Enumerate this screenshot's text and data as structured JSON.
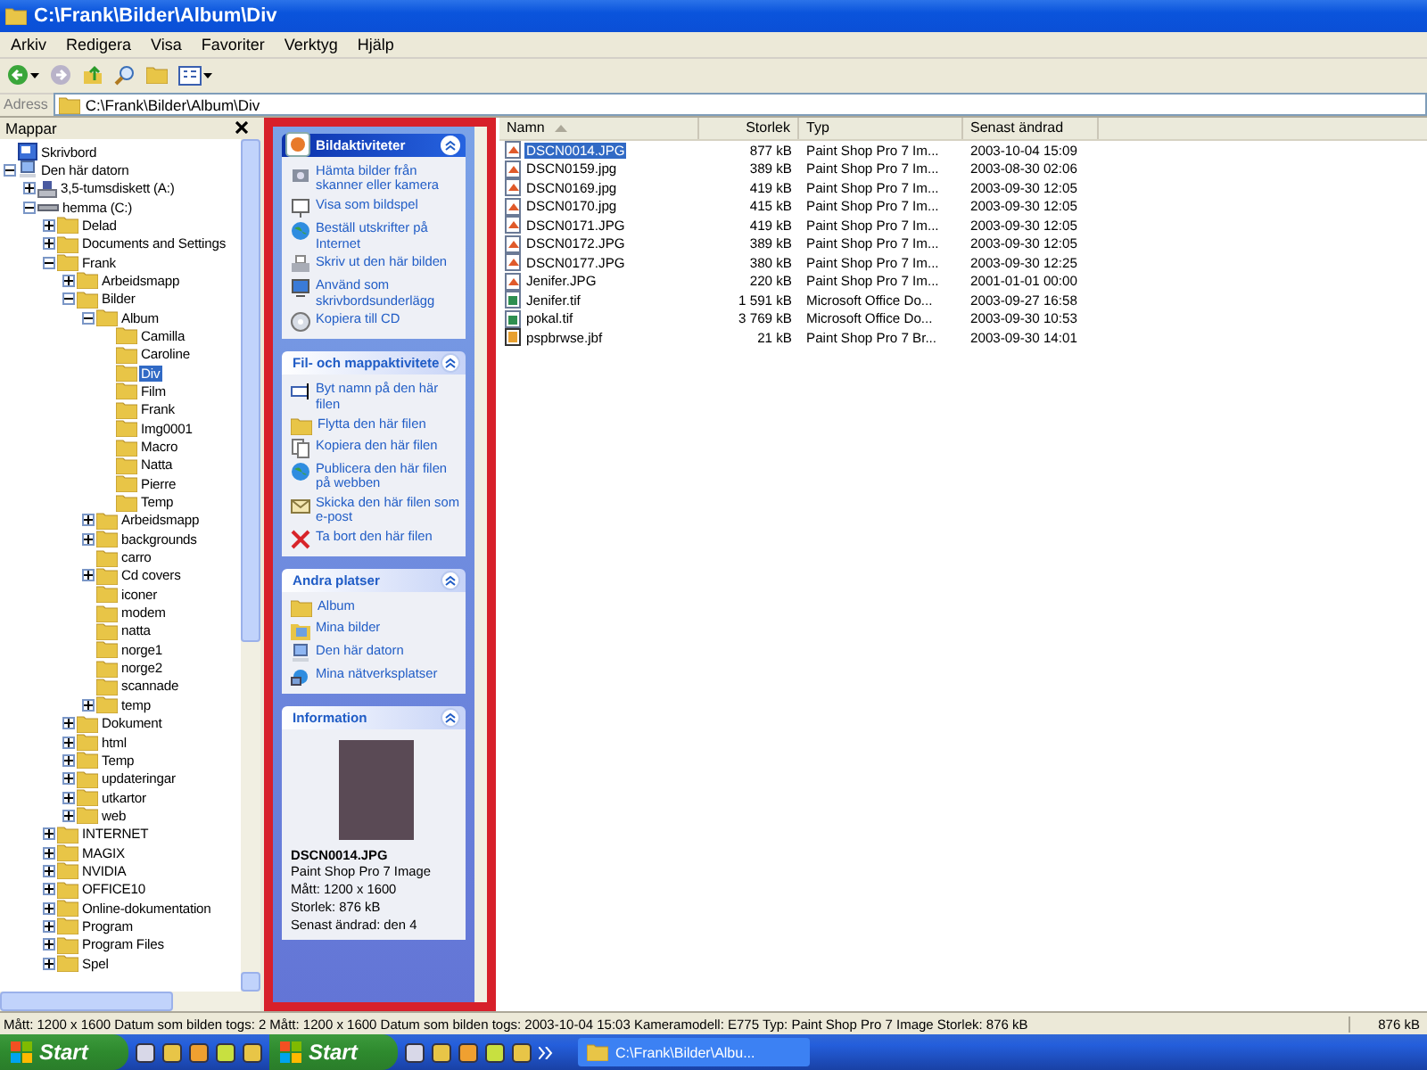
{
  "window": {
    "title": "C:\\Frank\\Bilder\\Album\\Div"
  },
  "menu": [
    "Arkiv",
    "Redigera",
    "Visa",
    "Favoriter",
    "Verktyg",
    "Hjälp"
  ],
  "address": {
    "label": "Adress",
    "value": "C:\\Frank\\Bilder\\Album\\Div"
  },
  "folders_pane": {
    "title": "Mappar",
    "tree": [
      {
        "label": "Skrivbord",
        "kind": "desktop",
        "selected": false
      },
      {
        "label": "Den här datorn",
        "kind": "computer",
        "expanded": true,
        "selected": false,
        "children": [
          {
            "label": "3,5-tumsdiskett (A:)",
            "kind": "floppy",
            "expanded": false,
            "selected": false
          },
          {
            "label": "hemma (C:)",
            "kind": "drive",
            "expanded": true,
            "selected": false,
            "children": [
              {
                "label": "Delad",
                "kind": "folder",
                "expanded": false,
                "selected": false
              },
              {
                "label": "Documents and Settings",
                "kind": "folder",
                "expanded": false,
                "selected": false
              },
              {
                "label": "Frank",
                "kind": "folder",
                "expanded": true,
                "selected": false,
                "children": [
                  {
                    "label": "Arbeidsmapp",
                    "kind": "folder",
                    "expanded": false,
                    "selected": false
                  },
                  {
                    "label": "Bilder",
                    "kind": "folder",
                    "expanded": true,
                    "selected": false,
                    "children": [
                      {
                        "label": "Album",
                        "kind": "folder",
                        "expanded": true,
                        "selected": false,
                        "children": [
                          {
                            "label": "Camilla",
                            "kind": "folder",
                            "selected": false
                          },
                          {
                            "label": "Caroline",
                            "kind": "folder",
                            "selected": false
                          },
                          {
                            "label": "Div",
                            "kind": "folder",
                            "selected": true
                          },
                          {
                            "label": "Film",
                            "kind": "folder",
                            "selected": false
                          },
                          {
                            "label": "Frank",
                            "kind": "folder",
                            "selected": false
                          },
                          {
                            "label": "Img0001",
                            "kind": "folder",
                            "selected": false
                          },
                          {
                            "label": "Macro",
                            "kind": "folder",
                            "selected": false
                          },
                          {
                            "label": "Natta",
                            "kind": "folder",
                            "selected": false
                          },
                          {
                            "label": "Pierre",
                            "kind": "folder",
                            "selected": false
                          },
                          {
                            "label": "Temp",
                            "kind": "folder",
                            "selected": false
                          }
                        ]
                      },
                      {
                        "label": "Arbeidsmapp",
                        "kind": "folder",
                        "expanded": false,
                        "selected": false
                      },
                      {
                        "label": "backgrounds",
                        "kind": "folder",
                        "expanded": false,
                        "selected": false
                      },
                      {
                        "label": "carro",
                        "kind": "folder",
                        "selected": false
                      },
                      {
                        "label": "Cd covers",
                        "kind": "folder",
                        "expanded": false,
                        "selected": false
                      },
                      {
                        "label": "iconer",
                        "kind": "folder",
                        "selected": false
                      },
                      {
                        "label": "modem",
                        "kind": "folder",
                        "selected": false
                      },
                      {
                        "label": "natta",
                        "kind": "folder",
                        "selected": false
                      },
                      {
                        "label": "norge1",
                        "kind": "folder",
                        "selected": false
                      },
                      {
                        "label": "norge2",
                        "kind": "folder",
                        "selected": false
                      },
                      {
                        "label": "scannade",
                        "kind": "folder",
                        "selected": false
                      },
                      {
                        "label": "temp",
                        "kind": "folder",
                        "expanded": false,
                        "selected": false
                      }
                    ]
                  },
                  {
                    "label": "Dokument",
                    "kind": "folder",
                    "expanded": false,
                    "selected": false
                  },
                  {
                    "label": "html",
                    "kind": "folder",
                    "expanded": false,
                    "selected": false
                  },
                  {
                    "label": "Temp",
                    "kind": "folder",
                    "expanded": false,
                    "selected": false
                  },
                  {
                    "label": "updateringar",
                    "kind": "folder",
                    "expanded": false,
                    "selected": false
                  },
                  {
                    "label": "utkartor",
                    "kind": "folder",
                    "expanded": false,
                    "selected": false
                  },
                  {
                    "label": "web",
                    "kind": "folder",
                    "expanded": false,
                    "selected": false
                  }
                ]
              },
              {
                "label": "INTERNET",
                "kind": "folder",
                "expanded": false,
                "selected": false
              },
              {
                "label": "MAGIX",
                "kind": "folder",
                "expanded": false,
                "selected": false
              },
              {
                "label": "NVIDIA",
                "kind": "folder",
                "expanded": false,
                "selected": false
              },
              {
                "label": "OFFICE10",
                "kind": "folder",
                "expanded": false,
                "selected": false
              },
              {
                "label": "Online-dokumentation",
                "kind": "folder",
                "expanded": false,
                "selected": false
              },
              {
                "label": "Program",
                "kind": "folder",
                "expanded": false,
                "selected": false
              },
              {
                "label": "Program Files",
                "kind": "folder",
                "expanded": false,
                "selected": false
              },
              {
                "label": "Spel",
                "kind": "folder",
                "expanded": false,
                "selected": false
              }
            ]
          }
        ]
      }
    ]
  },
  "task_pane": {
    "sections": [
      {
        "kind": "special",
        "title": "Bildaktiviteter",
        "items": [
          {
            "label": "Hämta bilder från skanner eller kamera",
            "kind": "camera"
          },
          {
            "label": "Visa som bildspel",
            "kind": "slideshow"
          },
          {
            "label": "Beställ utskrifter på Internet",
            "kind": "globe"
          },
          {
            "label": "Skriv ut den här bilden",
            "kind": "printer"
          },
          {
            "label": "Använd som skrivbordsunderlägg",
            "kind": "desktop"
          },
          {
            "label": "Kopiera till CD",
            "kind": "cd"
          }
        ]
      },
      {
        "kind": "normal",
        "title": "Fil- och mappaktivitete",
        "items": [
          {
            "label": "Byt namn på den här filen",
            "kind": "rename"
          },
          {
            "label": "Flytta den här filen",
            "kind": "folder"
          },
          {
            "label": "Kopiera den här filen",
            "kind": "copy"
          },
          {
            "label": "Publicera den här filen på webben",
            "kind": "globe"
          },
          {
            "label": "Skicka den här filen som e-post",
            "kind": "mail"
          },
          {
            "label": "Ta bort den här filen",
            "kind": "delete"
          }
        ]
      },
      {
        "kind": "normal",
        "title": "Andra platser",
        "items": [
          {
            "label": "Album",
            "kind": "folder"
          },
          {
            "label": "Mina bilder",
            "kind": "pictures"
          },
          {
            "label": "Den här datorn",
            "kind": "computer"
          },
          {
            "label": "Mina nätverksplatser",
            "kind": "network"
          }
        ]
      },
      {
        "kind": "info",
        "title": "Information",
        "file_name": "DSCN0014.JPG",
        "file_type": "Paint Shop Pro 7 Image",
        "details": [
          "Mått: 1200 x 1600",
          "Storlek: 876 kB",
          "Senast ändrad: den 4"
        ]
      }
    ]
  },
  "file_list": {
    "columns": [
      {
        "label": "Namn",
        "sorted": true
      },
      {
        "label": "Storlek",
        "sorted": false
      },
      {
        "label": "Typ",
        "sorted": false
      },
      {
        "label": "Senast ändrad",
        "sorted": false
      }
    ],
    "rows": [
      {
        "name": "DSCN0014.JPG",
        "size": "877 kB",
        "type": "Paint Shop Pro 7 Im...",
        "modified": "2003-10-04 15:09",
        "kind": "image",
        "selected": true
      },
      {
        "name": "DSCN0159.jpg",
        "size": "389 kB",
        "type": "Paint Shop Pro 7 Im...",
        "modified": "2003-08-30 02:06",
        "kind": "image",
        "selected": false
      },
      {
        "name": "DSCN0169.jpg",
        "size": "419 kB",
        "type": "Paint Shop Pro 7 Im...",
        "modified": "2003-09-30 12:05",
        "kind": "image",
        "selected": false
      },
      {
        "name": "DSCN0170.jpg",
        "size": "415 kB",
        "type": "Paint Shop Pro 7 Im...",
        "modified": "2003-09-30 12:05",
        "kind": "image",
        "selected": false
      },
      {
        "name": "DSCN0171.JPG",
        "size": "419 kB",
        "type": "Paint Shop Pro 7 Im...",
        "modified": "2003-09-30 12:05",
        "kind": "image",
        "selected": false
      },
      {
        "name": "DSCN0172.JPG",
        "size": "389 kB",
        "type": "Paint Shop Pro 7 Im...",
        "modified": "2003-09-30 12:05",
        "kind": "image",
        "selected": false
      },
      {
        "name": "DSCN0177.JPG",
        "size": "380 kB",
        "type": "Paint Shop Pro 7 Im...",
        "modified": "2003-09-30 12:25",
        "kind": "image",
        "selected": false
      },
      {
        "name": "Jenifer.JPG",
        "size": "220 kB",
        "type": "Paint Shop Pro 7 Im...",
        "modified": "2001-01-01 00:00",
        "kind": "image",
        "selected": false
      },
      {
        "name": "Jenifer.tif",
        "size": "1 591 kB",
        "type": "Microsoft Office Do...",
        "modified": "2003-09-27 16:58",
        "kind": "document",
        "selected": false
      },
      {
        "name": "pokal.tif",
        "size": "3 769 kB",
        "type": "Microsoft Office Do...",
        "modified": "2003-09-30 10:53",
        "kind": "document",
        "selected": false
      },
      {
        "name": "pspbrwse.jbf",
        "size": "21 kB",
        "type": "Paint Shop Pro 7 Br...",
        "modified": "2003-09-30 14:01",
        "kind": "browse",
        "selected": false
      }
    ]
  },
  "status_bar": {
    "texts": [
      "Mått: 1200 x 1600 Datum som bilden togs: 2",
      "Mått: 1200 x 1600 Datum som bilden togs: 2003-10-04 15:03 Kameramodell: E775 Typ: Paint Shop Pro 7 Image Storlek: 876 kB"
    ],
    "size": "876 kB"
  },
  "taskbar": {
    "start_buttons": [
      "Start",
      "Start"
    ],
    "tasks": [
      "C:\\Frank\\Bilder\\Albu..."
    ]
  }
}
